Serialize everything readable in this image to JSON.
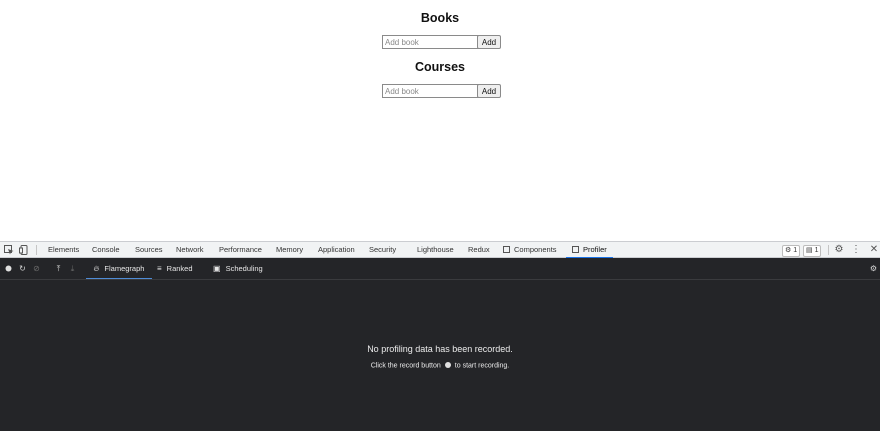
{
  "page": {
    "books": {
      "heading": "Books",
      "input_placeholder": "Add book",
      "button_label": "Add"
    },
    "courses": {
      "heading": "Courses",
      "input_placeholder": "Add book",
      "button_label": "Add"
    }
  },
  "devtools": {
    "tabs": [
      {
        "label": "Elements"
      },
      {
        "label": "Console"
      },
      {
        "label": "Sources"
      },
      {
        "label": "Network"
      },
      {
        "label": "Performance"
      },
      {
        "label": "Memory"
      },
      {
        "label": "Application"
      },
      {
        "label": "Security"
      },
      {
        "label": "Lighthouse"
      },
      {
        "label": "Redux"
      },
      {
        "label": "Components"
      },
      {
        "label": "Profiler"
      }
    ],
    "active_tab": "Profiler",
    "issues_badge": "1",
    "messages_badge": "1",
    "colors": {
      "accent": "#1a73e8",
      "panel_bg": "#242528",
      "tabbar_bg": "#f1f3f4"
    }
  },
  "profiler": {
    "tabs": [
      {
        "label": "Flamegraph",
        "icon": "flame-icon"
      },
      {
        "label": "Ranked",
        "icon": "ranked-list-icon"
      },
      {
        "label": "Scheduling",
        "icon": "calendar-icon"
      }
    ],
    "empty_title": "No profiling data has been recorded.",
    "empty_hint_before": "Click the record button",
    "empty_hint_after": "to start recording."
  }
}
